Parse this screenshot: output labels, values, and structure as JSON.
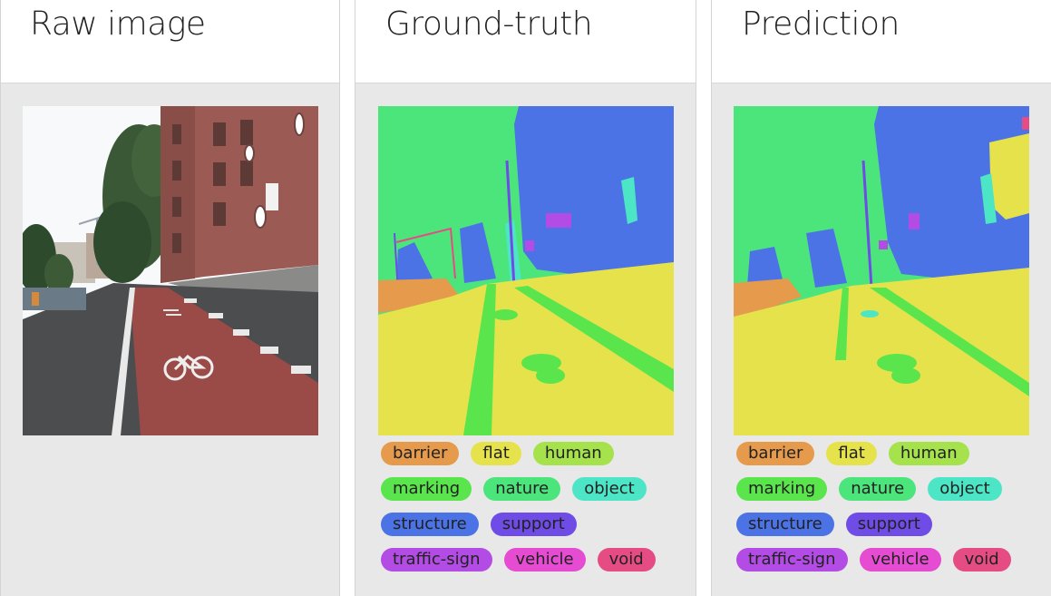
{
  "panels": {
    "raw": {
      "title": "Raw image"
    },
    "ground_truth": {
      "title": "Ground-truth"
    },
    "prediction": {
      "title": "Prediction"
    }
  },
  "legend": [
    {
      "label": "barrier",
      "color": "#e59a4c"
    },
    {
      "label": "flat",
      "color": "#e5e24c"
    },
    {
      "label": "human",
      "color": "#a5e24c"
    },
    {
      "label": "marking",
      "color": "#5ae54c"
    },
    {
      "label": "nature",
      "color": "#4ce57c"
    },
    {
      "label": "object",
      "color": "#4ce5c6"
    },
    {
      "label": "structure",
      "color": "#4c73e5"
    },
    {
      "label": "support",
      "color": "#6e4ce5"
    },
    {
      "label": "traffic-sign",
      "color": "#b34ce5"
    },
    {
      "label": "vehicle",
      "color": "#e54cd2"
    },
    {
      "label": "void",
      "color": "#e54c83"
    }
  ]
}
